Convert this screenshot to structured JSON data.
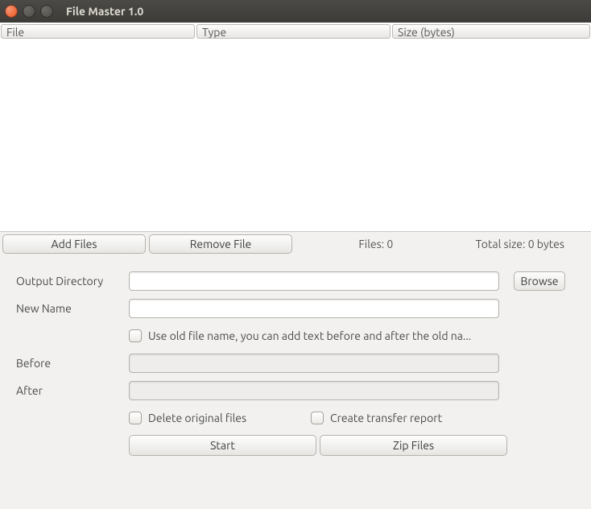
{
  "window": {
    "title": "File Master 1.0"
  },
  "table": {
    "columns": {
      "file": "File",
      "type": "Type",
      "size": "Size (bytes)"
    },
    "rows": []
  },
  "toolbar": {
    "add_files": "Add Files",
    "remove_file": "Remove File"
  },
  "stats": {
    "files_label": "Files:",
    "files_count": "0",
    "total_label": "Total size:",
    "total_value": "0 bytes"
  },
  "form": {
    "output_dir_label": "Output Directory",
    "output_dir_value": "",
    "browse_label": "Browse",
    "new_name_label": "New Name",
    "new_name_value": "",
    "use_old_name_label": "Use old file name, you can add text before and after the old na...",
    "before_label": "Before",
    "before_value": "",
    "after_label": "After",
    "after_value": "",
    "delete_original_label": "Delete original files",
    "create_report_label": "Create transfer report",
    "start_label": "Start",
    "zip_label": "Zip Files"
  }
}
